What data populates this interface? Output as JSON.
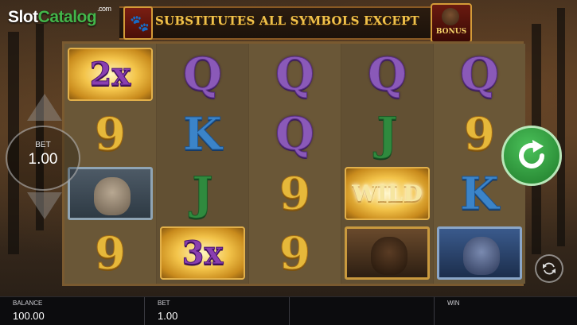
{
  "watermark": {
    "part1": "Slot",
    "part2": "Catalog",
    "suffix": ".com"
  },
  "banner": {
    "text": "SUBSTITUTES ALL SYMBOLS EXCEPT",
    "bonus_label": "BONUS",
    "left_icon": "paw-icon"
  },
  "reels": [
    [
      {
        "type": "multiplier",
        "label": "2x"
      },
      {
        "type": "card",
        "label": "9",
        "suit": "nine"
      },
      {
        "type": "animal",
        "label": "lynx"
      },
      {
        "type": "card",
        "label": "9",
        "suit": "nine"
      }
    ],
    [
      {
        "type": "card",
        "label": "Q",
        "suit": "q"
      },
      {
        "type": "card",
        "label": "K",
        "suit": "k"
      },
      {
        "type": "card",
        "label": "J",
        "suit": "j"
      },
      {
        "type": "multiplier",
        "label": "3x"
      }
    ],
    [
      {
        "type": "card",
        "label": "Q",
        "suit": "q"
      },
      {
        "type": "card",
        "label": "Q",
        "suit": "q"
      },
      {
        "type": "card",
        "label": "9",
        "suit": "nine"
      },
      {
        "type": "card",
        "label": "9",
        "suit": "nine"
      }
    ],
    [
      {
        "type": "card",
        "label": "Q",
        "suit": "q"
      },
      {
        "type": "card",
        "label": "J",
        "suit": "j"
      },
      {
        "type": "wild",
        "label": "WILD"
      },
      {
        "type": "animal",
        "label": "bear"
      }
    ],
    [
      {
        "type": "card",
        "label": "Q",
        "suit": "q"
      },
      {
        "type": "card",
        "label": "9",
        "suit": "nine"
      },
      {
        "type": "card",
        "label": "K",
        "suit": "k"
      },
      {
        "type": "animal",
        "label": "wolf"
      }
    ]
  ],
  "bet_control": {
    "label": "BET",
    "value": "1.00"
  },
  "controls": {
    "spin_icon": "spin-arrow-icon",
    "autoplay_icon": "autoplay-icon"
  },
  "bottom_bar": {
    "balance_label": "BALANCE",
    "balance_value": "100.00",
    "bet_label": "BET",
    "bet_value": "1.00",
    "win_label": "WIN",
    "win_value": ""
  },
  "colors": {
    "spin_green": "#2fa03c",
    "banner_gold": "#f0c24a",
    "bar_bg": "#0c0c0e"
  }
}
